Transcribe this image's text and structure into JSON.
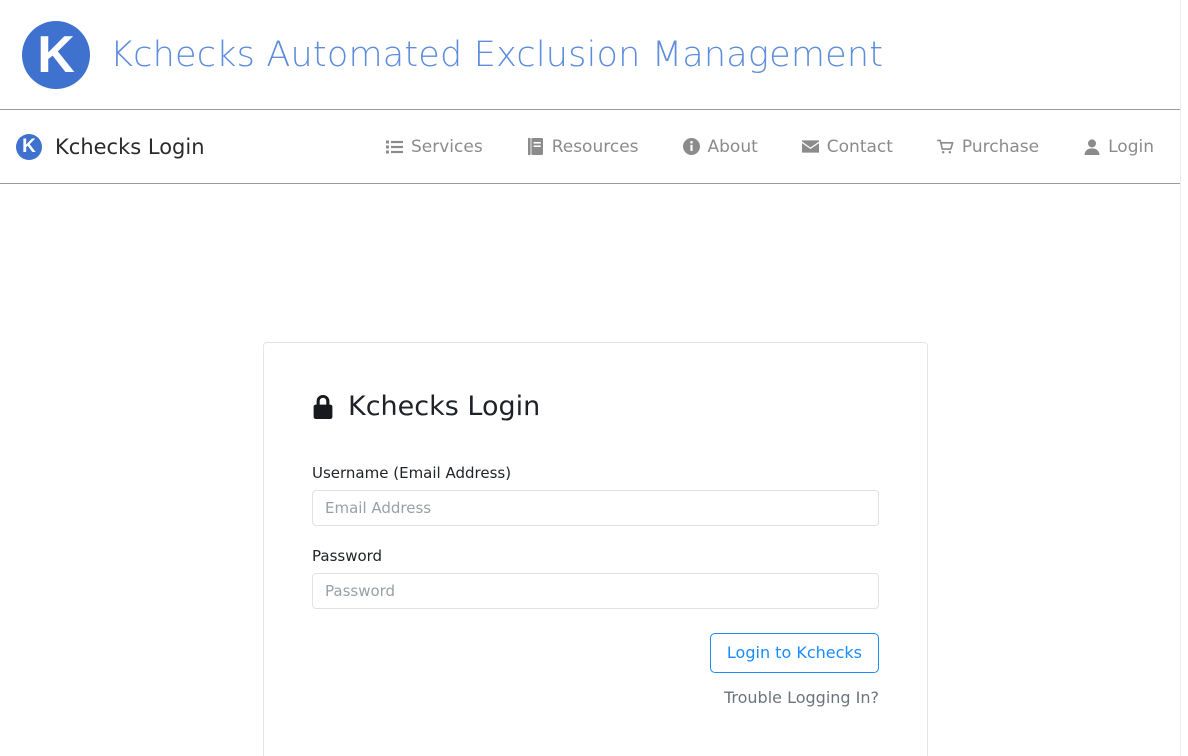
{
  "masthead": {
    "logo_letter": "K",
    "logo_icon": "kchecks-circle-logo",
    "title": "Kchecks Automated Exclusion Management",
    "brand_color": "#3f72cf",
    "title_color": "#5d8ddb"
  },
  "navbar": {
    "brand_logo_letter": "K",
    "brand_text": "Kchecks Login",
    "links": [
      {
        "label": "Services",
        "icon": "list-icon",
        "name": "nav-link-services"
      },
      {
        "label": "Resources",
        "icon": "book-icon",
        "name": "nav-link-resources"
      },
      {
        "label": "About",
        "icon": "info-icon",
        "name": "nav-link-about"
      },
      {
        "label": "Contact",
        "icon": "envelope-icon",
        "name": "nav-link-contact"
      },
      {
        "label": "Purchase",
        "icon": "cart-icon",
        "name": "nav-link-purchase"
      },
      {
        "label": "Login",
        "icon": "user-icon",
        "name": "nav-link-login"
      }
    ],
    "link_color": "#8b8b8b"
  },
  "login_card": {
    "title": "Kchecks Login",
    "title_icon": "lock-icon",
    "username": {
      "label": "Username (Email Address)",
      "placeholder": "Email Address",
      "value": ""
    },
    "password": {
      "label": "Password",
      "placeholder": "Password",
      "value": ""
    },
    "submit_label": "Login to Kchecks",
    "submit_color": "#1a8cff",
    "trouble_link": "Trouble Logging In?"
  }
}
